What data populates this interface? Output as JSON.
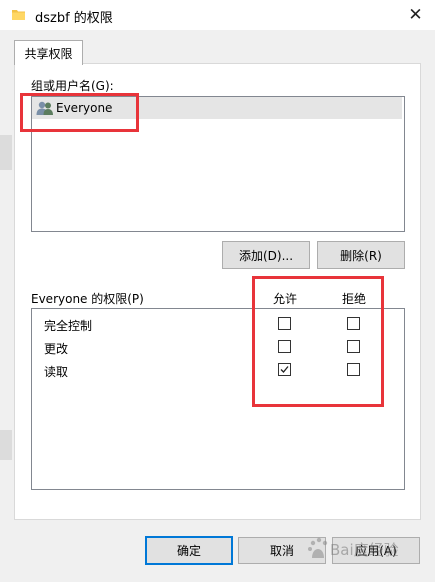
{
  "window": {
    "title": "dszbf 的权限",
    "close_glyph": "✕"
  },
  "tabs": [
    {
      "label": "共享权限"
    }
  ],
  "users": {
    "label": "组或用户名(G):",
    "items": [
      {
        "name": "Everyone",
        "icon": "users-icon"
      }
    ]
  },
  "buttons": {
    "add": "添加(D)...",
    "remove": "删除(R)"
  },
  "permissions": {
    "label": "Everyone 的权限(P)",
    "allow_header": "允许",
    "deny_header": "拒绝",
    "rows": [
      {
        "name": "完全控制",
        "allow": false,
        "deny": false
      },
      {
        "name": "更改",
        "allow": false,
        "deny": false
      },
      {
        "name": "读取",
        "allow": true,
        "deny": false
      }
    ]
  },
  "footer": {
    "ok": "确定",
    "cancel": "取消",
    "apply": "应用(A)"
  },
  "watermark": {
    "text": "Bai度经验"
  },
  "colors": {
    "highlight": "#e8343a",
    "focus": "#0078d7",
    "selection": "#e5e5e5"
  }
}
